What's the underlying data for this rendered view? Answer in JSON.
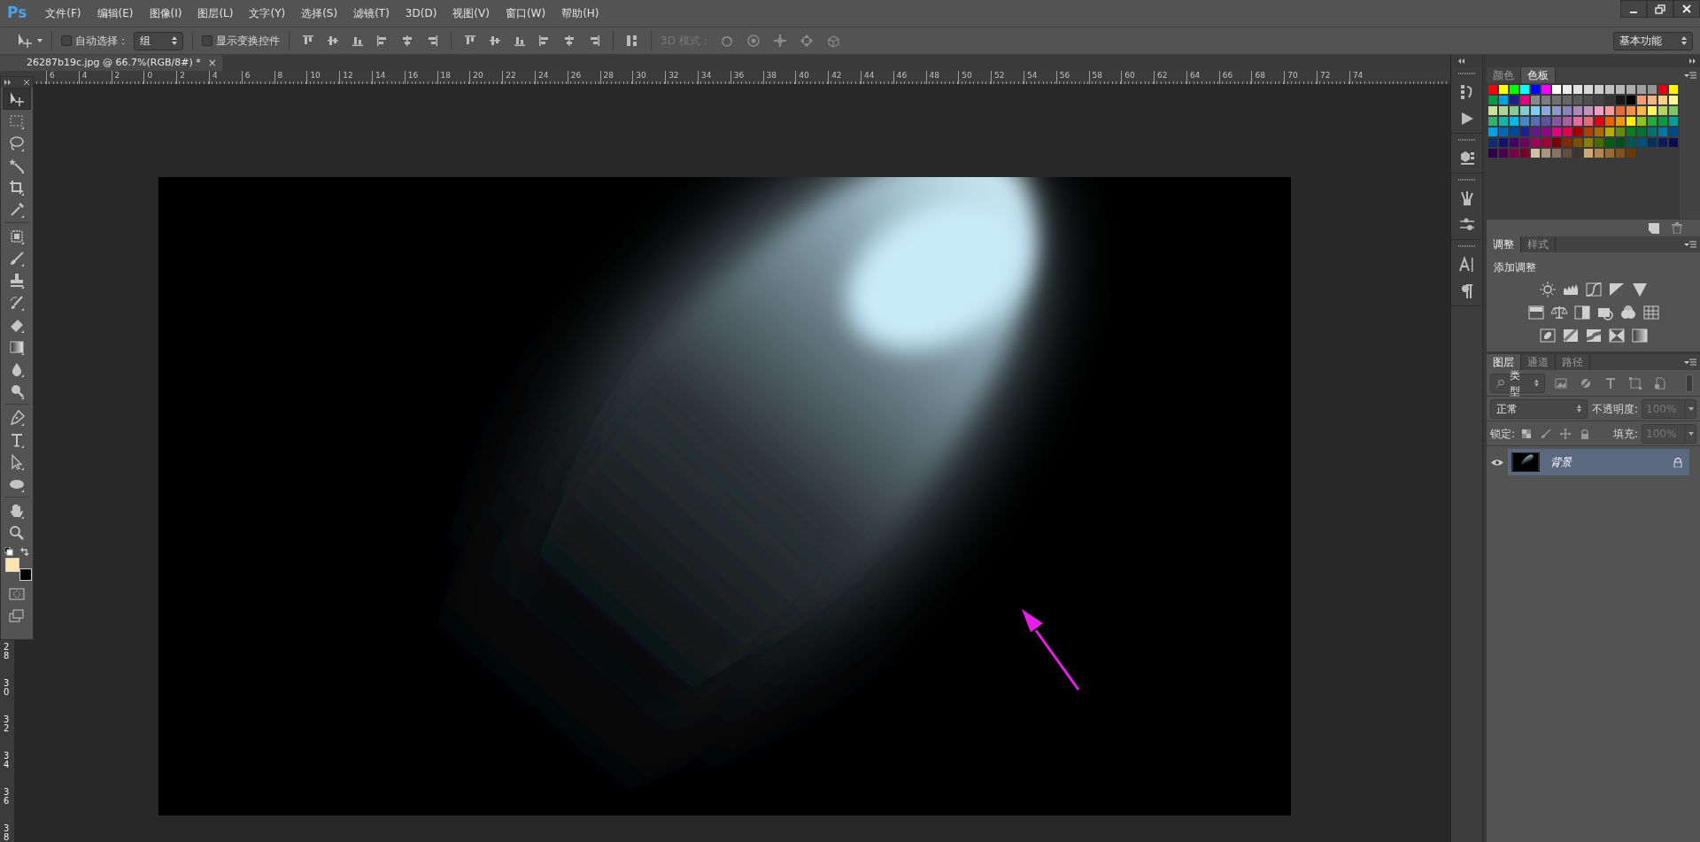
{
  "app": {
    "logo": "Ps"
  },
  "menu": [
    "文件(F)",
    "编辑(E)",
    "图像(I)",
    "图层(L)",
    "文字(Y)",
    "选择(S)",
    "滤镜(T)",
    "3D(D)",
    "视图(V)",
    "窗口(W)",
    "帮助(H)"
  ],
  "options_bar": {
    "auto_select": {
      "label": "自动选择：",
      "checked": false
    },
    "target": {
      "value": "组"
    },
    "show_transform": {
      "label": "显示变换控件",
      "checked": false
    },
    "mode_label": "3D 模式：",
    "workspace": "基本功能"
  },
  "document_tab": {
    "title": "26287b19c.jpg @ 66.7%(RGB/8#) *",
    "close": "×"
  },
  "ruler_h": [
    "6",
    "4",
    "2",
    "0",
    "2",
    "4",
    "6",
    "8",
    "10",
    "12",
    "14",
    "16",
    "18",
    "20",
    "22",
    "24",
    "26",
    "28",
    "30",
    "32",
    "34",
    "36",
    "38",
    "40",
    "42",
    "44",
    "46",
    "48",
    "50",
    "52",
    "54",
    "56",
    "58",
    "60",
    "62",
    "64",
    "66",
    "68",
    "70",
    "72",
    "74"
  ],
  "ruler_v": [
    "28",
    "30",
    "32",
    "34",
    "36",
    "38"
  ],
  "tool_groups": [
    [
      {
        "kind": "move",
        "selected": true
      },
      {
        "kind": "marquee",
        "selected": false
      },
      {
        "kind": "lasso",
        "selected": false
      },
      {
        "kind": "wand",
        "selected": false
      },
      {
        "kind": "crop",
        "selected": false
      },
      {
        "kind": "eyedropper",
        "selected": false
      }
    ],
    [
      {
        "kind": "healing",
        "selected": false
      },
      {
        "kind": "brush",
        "selected": false
      },
      {
        "kind": "stamp",
        "selected": false
      },
      {
        "kind": "history",
        "selected": false
      },
      {
        "kind": "eraser",
        "selected": false
      },
      {
        "kind": "gradient",
        "selected": false
      },
      {
        "kind": "blur",
        "selected": false
      },
      {
        "kind": "dodge",
        "selected": false
      }
    ],
    [
      {
        "kind": "pen",
        "selected": false
      },
      {
        "kind": "type",
        "selected": false
      },
      {
        "kind": "path",
        "selected": false
      },
      {
        "kind": "ellipse",
        "selected": false
      }
    ],
    [
      {
        "kind": "hand",
        "selected": false
      },
      {
        "kind": "zoom",
        "selected": false
      }
    ]
  ],
  "colors": [
    {
      "color": "#fde3b1"
    },
    {
      "color": "#000000"
    }
  ],
  "swatch_panel": {
    "tabs": [
      {
        "label": "颜色",
        "selected": false
      },
      {
        "label": "色板",
        "selected": true
      }
    ],
    "swatches": [
      {
        "color": "#ff0000"
      },
      {
        "color": "#ffff00"
      },
      {
        "color": "#00ff00"
      },
      {
        "color": "#00ffff"
      },
      {
        "color": "#0000ff"
      },
      {
        "color": "#ff00ff"
      },
      {
        "color": "#ffffff"
      },
      {
        "color": "#ebebeb"
      },
      {
        "color": "#e1e1e1"
      },
      {
        "color": "#d7d7d7"
      },
      {
        "color": "#cccccc"
      },
      {
        "color": "#c2c2c2"
      },
      {
        "color": "#b7b7b7"
      },
      {
        "color": "#acacac"
      },
      {
        "color": "#a0a0a0"
      },
      {
        "color": "#959595"
      },
      {
        "color": "#e60012"
      },
      {
        "color": "#fff100"
      },
      {
        "color": "#009944"
      },
      {
        "color": "#00a0e9"
      },
      {
        "color": "#1d2088"
      },
      {
        "color": "#e4007f"
      },
      {
        "color": "#898989"
      },
      {
        "color": "#7d7d7d"
      },
      {
        "color": "#717171"
      },
      {
        "color": "#666666"
      },
      {
        "color": "#5a5a5a"
      },
      {
        "color": "#4f4f4f"
      },
      {
        "color": "#434343"
      },
      {
        "color": "#363636"
      },
      {
        "color": "#181818"
      },
      {
        "color": "#000000"
      },
      {
        "color": "#f29b76"
      },
      {
        "color": "#f6b37f"
      },
      {
        "color": "#facd89"
      },
      {
        "color": "#fff799"
      },
      {
        "color": "#cce198"
      },
      {
        "color": "#acd598"
      },
      {
        "color": "#89c997"
      },
      {
        "color": "#84ccc9"
      },
      {
        "color": "#7ecef4"
      },
      {
        "color": "#88abda"
      },
      {
        "color": "#8c97cb"
      },
      {
        "color": "#8f82bc"
      },
      {
        "color": "#aa89bd"
      },
      {
        "color": "#c490bf"
      },
      {
        "color": "#f19ec2"
      },
      {
        "color": "#f29c9f"
      },
      {
        "color": "#eb6941"
      },
      {
        "color": "#f19149"
      },
      {
        "color": "#f8b551"
      },
      {
        "color": "#fff45c"
      },
      {
        "color": "#b3d465"
      },
      {
        "color": "#80c269"
      },
      {
        "color": "#32b16c"
      },
      {
        "color": "#13b5b1"
      },
      {
        "color": "#00b7ee"
      },
      {
        "color": "#448aca"
      },
      {
        "color": "#556fb5"
      },
      {
        "color": "#5f52a0"
      },
      {
        "color": "#8957a1"
      },
      {
        "color": "#ae5da1"
      },
      {
        "color": "#ea68a2"
      },
      {
        "color": "#eb6877"
      },
      {
        "color": "#e60013"
      },
      {
        "color": "#eb6100"
      },
      {
        "color": "#f39800"
      },
      {
        "color": "#fff101"
      },
      {
        "color": "#8fc31f"
      },
      {
        "color": "#22ac38"
      },
      {
        "color": "#009945"
      },
      {
        "color": "#009e96"
      },
      {
        "color": "#00a0ea"
      },
      {
        "color": "#0068b7"
      },
      {
        "color": "#00479d"
      },
      {
        "color": "#1d2089"
      },
      {
        "color": "#601986"
      },
      {
        "color": "#920783"
      },
      {
        "color": "#e40080"
      },
      {
        "color": "#e5004f"
      },
      {
        "color": "#a40000"
      },
      {
        "color": "#a84200"
      },
      {
        "color": "#ac6a00"
      },
      {
        "color": "#b7aa00"
      },
      {
        "color": "#638c0b"
      },
      {
        "color": "#097c25"
      },
      {
        "color": "#007130"
      },
      {
        "color": "#00736d"
      },
      {
        "color": "#0075a9"
      },
      {
        "color": "#004986"
      },
      {
        "color": "#0f2e6e"
      },
      {
        "color": "#13136b"
      },
      {
        "color": "#440062"
      },
      {
        "color": "#6a005f"
      },
      {
        "color": "#a0005a"
      },
      {
        "color": "#a00035"
      },
      {
        "color": "#7d0000"
      },
      {
        "color": "#7f2d00"
      },
      {
        "color": "#7f4f00"
      },
      {
        "color": "#877f00"
      },
      {
        "color": "#4a6a00"
      },
      {
        "color": "#005c15"
      },
      {
        "color": "#004d20"
      },
      {
        "color": "#005652"
      },
      {
        "color": "#004f7c"
      },
      {
        "color": "#00305e"
      },
      {
        "color": "#0d1a5c"
      },
      {
        "color": "#0b0b4d"
      },
      {
        "color": "#31004a"
      },
      {
        "color": "#4b0049"
      },
      {
        "color": "#7b0046"
      },
      {
        "color": "#7a0026"
      },
      {
        "color": "#d2c0a4"
      },
      {
        "color": "#a9967f"
      },
      {
        "color": "#857461"
      },
      {
        "color": "#5e5042"
      },
      {
        "color": "#3c3432"
      },
      {
        "color": "#cfa972"
      },
      {
        "color": "#b28850"
      },
      {
        "color": "#996c33"
      },
      {
        "color": "#81511c"
      },
      {
        "color": "#6a3906"
      }
    ]
  },
  "adjustments_panel": {
    "tabs": [
      {
        "label": "调整",
        "selected": true
      },
      {
        "label": "样式",
        "selected": false
      }
    ],
    "heading": "添加调整"
  },
  "layers_panel": {
    "tabs": [
      {
        "label": "图层",
        "selected": true
      },
      {
        "label": "通道",
        "selected": false
      },
      {
        "label": "路径",
        "selected": false
      }
    ],
    "filter": "类型",
    "blend_mode": "正常",
    "opacity_label": "不透明度:",
    "opacity": {
      "value": "100%",
      "disabled": true
    },
    "lock_label": "锁定:",
    "fill_label": "填充:",
    "fill": {
      "value": "100%",
      "disabled": true
    },
    "layers": [
      {
        "name": "背景",
        "visible": true,
        "selected": true,
        "locked": true
      }
    ]
  }
}
